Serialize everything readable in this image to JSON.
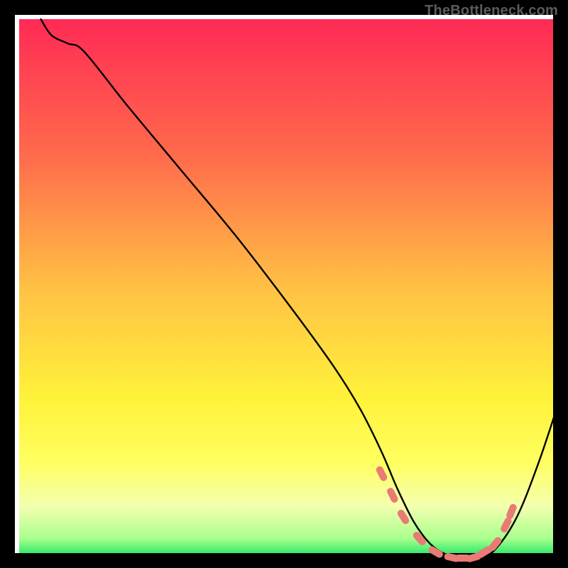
{
  "watermark": {
    "text": "TheBottleneck.com"
  },
  "chart_data": {
    "type": "line",
    "title": "",
    "xlabel": "",
    "ylabel": "",
    "xlim": [
      0,
      100
    ],
    "ylim": [
      0,
      100
    ],
    "grid": false,
    "legend": false,
    "background_gradient": {
      "stops": [
        {
          "offset": 0.0,
          "color": "#ff2a55"
        },
        {
          "offset": 0.25,
          "color": "#ff6a4c"
        },
        {
          "offset": 0.5,
          "color": "#ffc244"
        },
        {
          "offset": 0.7,
          "color": "#fff23a"
        },
        {
          "offset": 0.82,
          "color": "#ffff60"
        },
        {
          "offset": 0.9,
          "color": "#f4ffb0"
        },
        {
          "offset": 0.96,
          "color": "#a8ff8c"
        },
        {
          "offset": 1.0,
          "color": "#00e060"
        }
      ]
    },
    "series": [
      {
        "name": "bottleneck-curve",
        "stroke": "#000000",
        "stroke_width": 2.4,
        "x": [
          4,
          6,
          9,
          12,
          20,
          30,
          40,
          50,
          58,
          63,
          67,
          70,
          73,
          76,
          79,
          82,
          85,
          88,
          92,
          96,
          100
        ],
        "y": [
          100,
          97,
          95.5,
          94,
          84,
          72,
          60,
          47,
          36,
          28,
          20,
          13,
          7,
          3,
          1,
          0.3,
          0.4,
          2,
          8,
          18,
          30
        ]
      },
      {
        "name": "highlight-dots",
        "stroke": "#e97a74",
        "marker": "round",
        "marker_size": 10,
        "x": [
          67,
          69,
          71,
          74,
          77,
          80,
          82,
          84,
          86,
          88,
          90,
          91
        ],
        "y": [
          16,
          12,
          8,
          4,
          1.5,
          0.5,
          0.4,
          0.5,
          1.5,
          3,
          6.5,
          9
        ]
      }
    ]
  }
}
